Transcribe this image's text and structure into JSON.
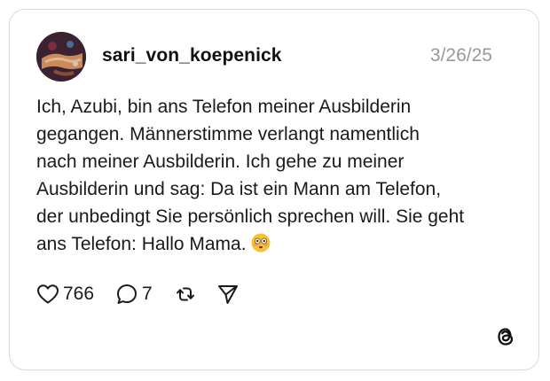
{
  "post": {
    "username": "sari_von_koepenick",
    "date": "3/26/25",
    "text_lines": [
      "Ich, Azubi, bin ans Telefon meiner Ausbilderin",
      "gegangen. Männerstimme verlangt namentlich",
      "nach meiner Ausbilderin. Ich gehe zu meiner",
      "Ausbilderin und sag: Da ist ein Mann am Telefon,",
      "der unbedingt Sie persönlich sprechen will. Sie geht",
      "ans Telefon: Hallo Mama."
    ],
    "emoji": "flushed-face-emoji"
  },
  "actions": {
    "likes": "766",
    "replies": "7",
    "like_icon": "heart-icon",
    "reply_icon": "speech-bubble-icon",
    "repost_icon": "repost-icon",
    "share_icon": "send-icon"
  },
  "brand": {
    "logo": "threads-logo-icon"
  }
}
